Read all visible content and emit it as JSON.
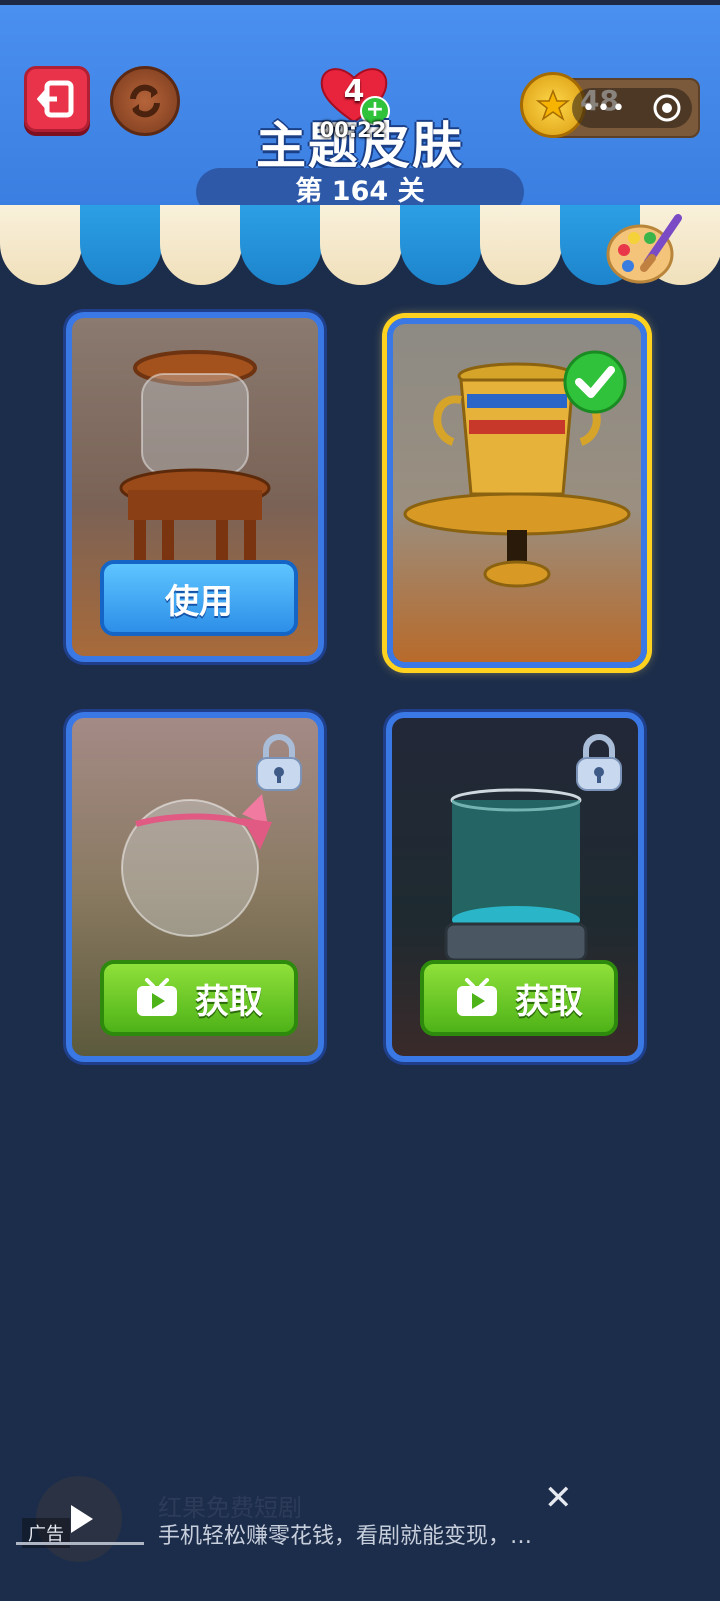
{
  "header": {
    "title": "主题皮肤",
    "level": "第 164 关",
    "lives": "4",
    "timer": "00:22",
    "coins": "48"
  },
  "cards": [
    {
      "name": "wooden-jar",
      "action": "使用",
      "state": "available"
    },
    {
      "name": "golden-trophy",
      "action": "",
      "state": "selected"
    },
    {
      "name": "glass-bowl-ribbon",
      "action": "获取",
      "state": "locked"
    },
    {
      "name": "teal-cylinder",
      "action": "获取",
      "state": "locked"
    }
  ],
  "ad": {
    "title": "红果免费短剧",
    "description": "手机轻松赚零花钱，看剧就能变现，…",
    "badge": "广告"
  },
  "colors": {
    "background": "#1c2d4b",
    "header_blue": "#4a90f0",
    "use_button": "#2d8fe8",
    "get_button": "#4eb318",
    "selected_border": "#ffd21f"
  }
}
